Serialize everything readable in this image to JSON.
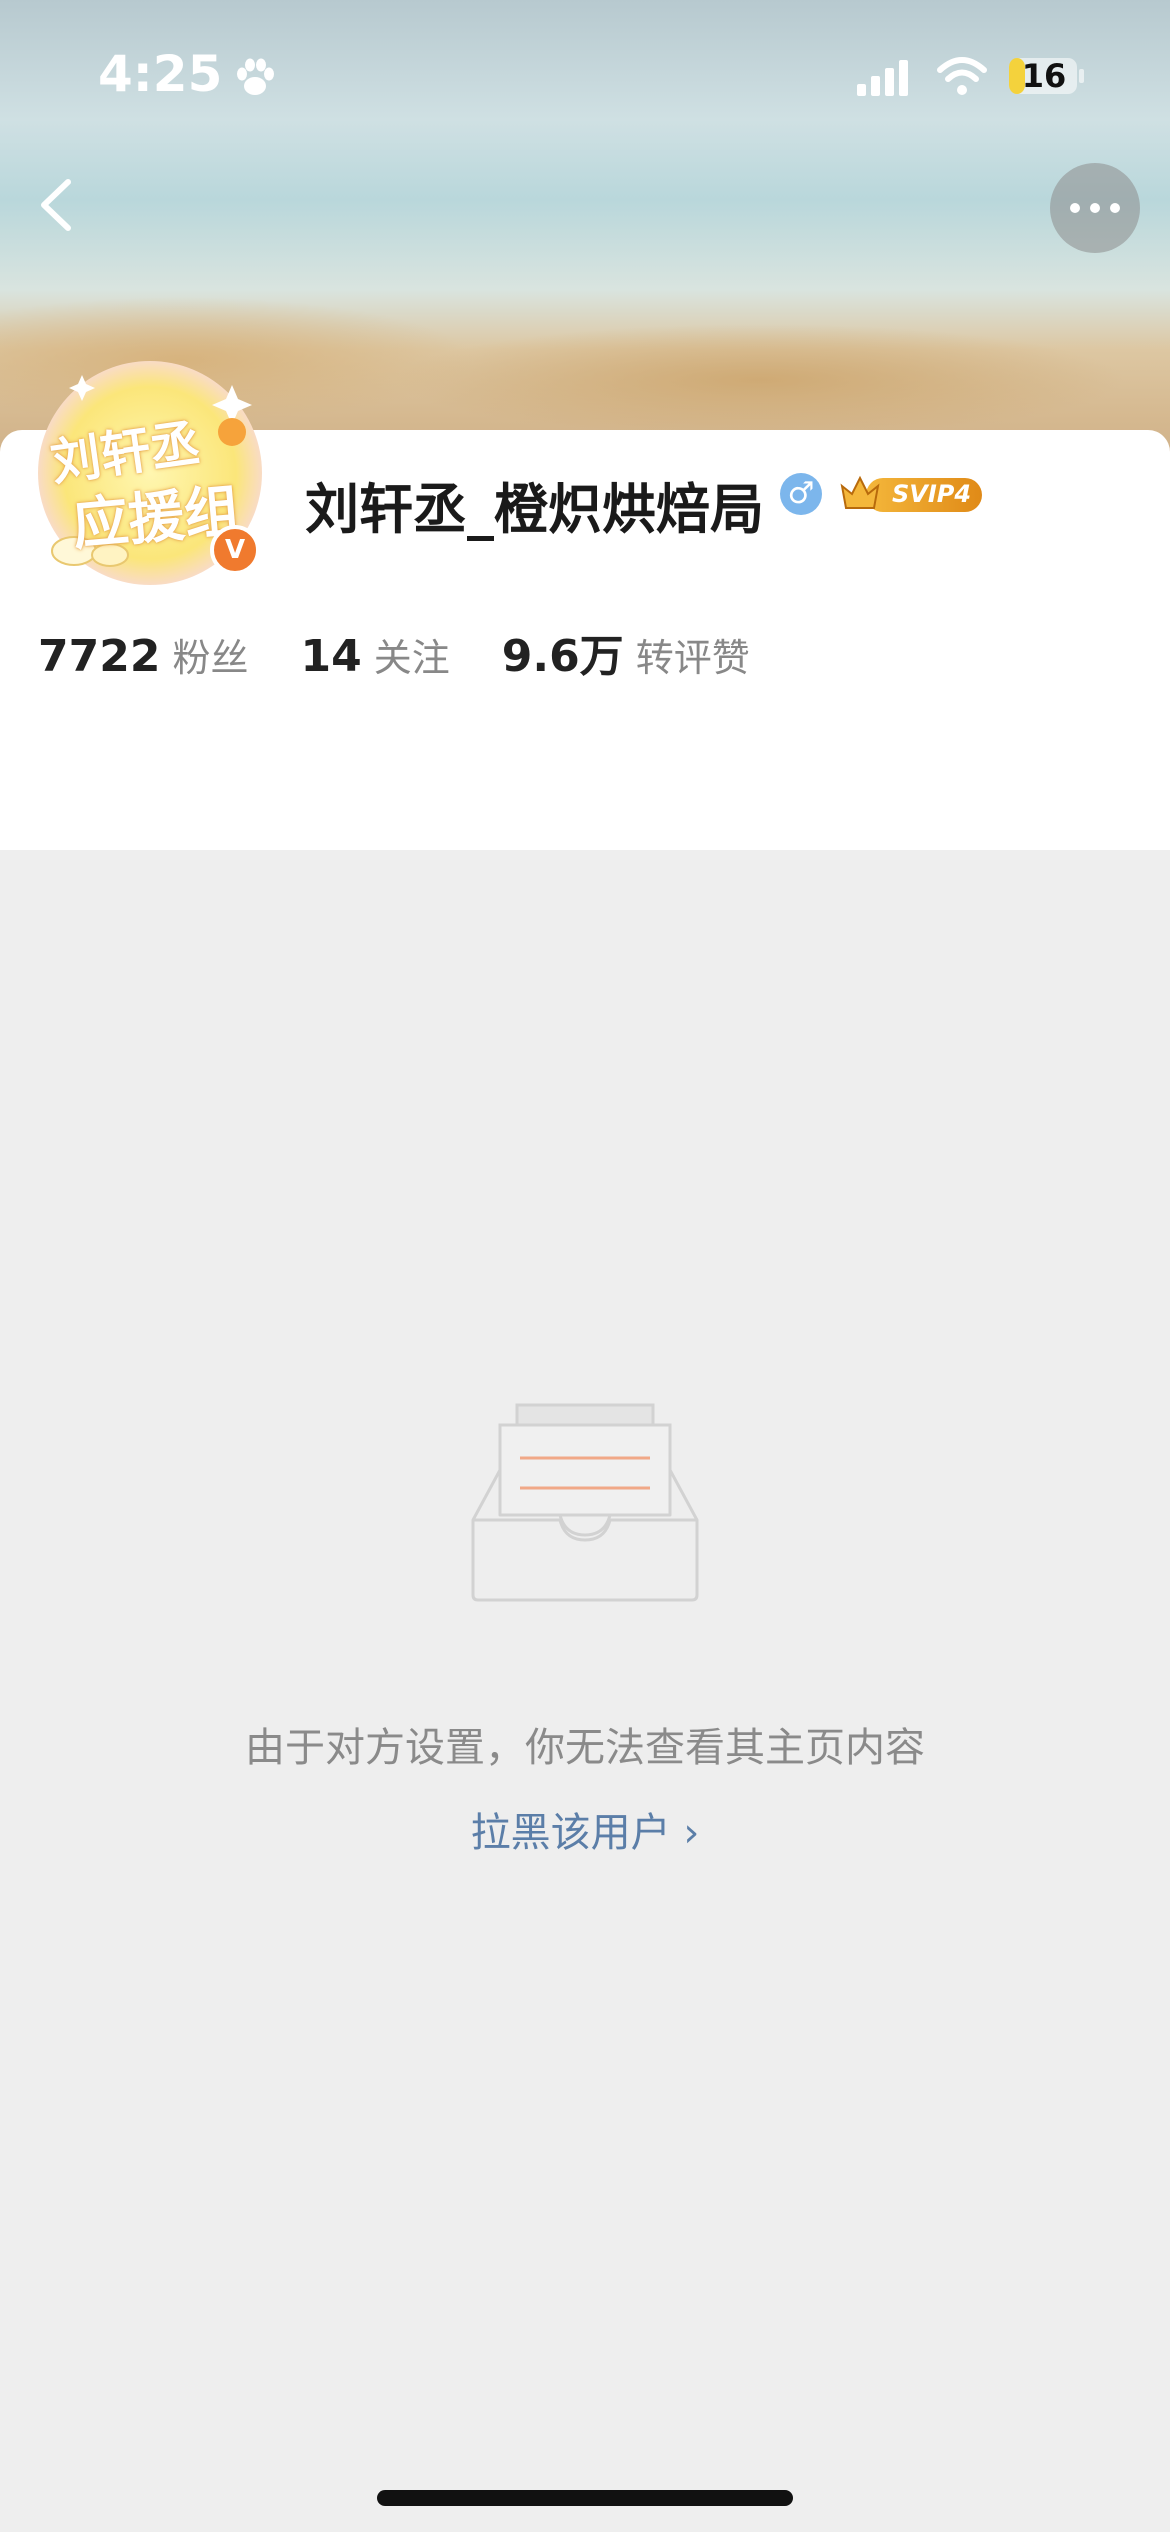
{
  "status_bar": {
    "time": "4:25",
    "battery": "16"
  },
  "profile": {
    "name": "刘轩丞_橙炽烘焙局",
    "gender_symbol": "♂",
    "vip_badge": "SVIP4",
    "avatar_text_line1": "刘轩丞",
    "avatar_text_line2": "应援组",
    "verified_mark": "V"
  },
  "stats": [
    {
      "value": "7722",
      "label": "粉丝"
    },
    {
      "value": "14",
      "label": "关注"
    },
    {
      "value": "9.6万",
      "label": "转评赞"
    }
  ],
  "empty_state": {
    "message": "由于对方设置，你无法查看其主页内容",
    "action": "拉黑该用户 ›"
  },
  "colors": {
    "link": "#5b7ea8",
    "verified": "#f07a2e",
    "gender": "#7cb6ec",
    "vip": "#f0a81e"
  },
  "icons": [
    "back-icon",
    "more-icon",
    "paw-icon",
    "signal-icon",
    "wifi-icon",
    "battery-icon",
    "male-icon",
    "inbox-illustration"
  ]
}
